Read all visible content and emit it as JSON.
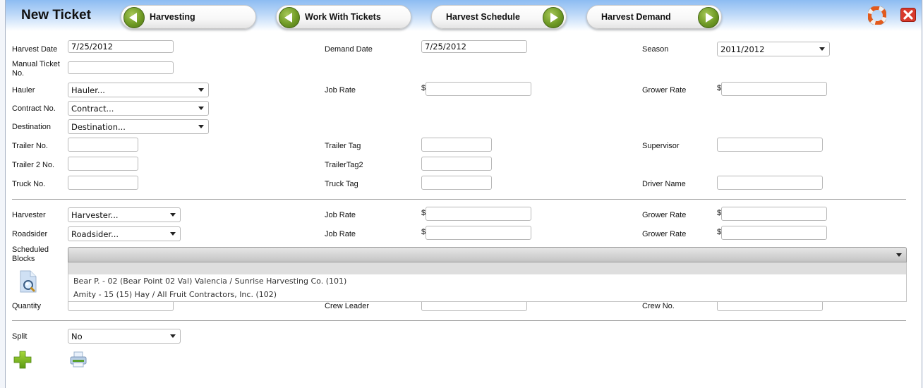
{
  "header": {
    "title": "New Ticket",
    "nav": [
      {
        "label": "Harvesting",
        "direction": "back"
      },
      {
        "label": "Work With Tickets",
        "direction": "back"
      },
      {
        "label": "Harvest Schedule",
        "direction": "forward"
      },
      {
        "label": "Harvest Demand",
        "direction": "forward"
      }
    ],
    "icons": {
      "help": "lifebuoy-icon",
      "close": "close-icon"
    }
  },
  "form": {
    "harvest_date": {
      "label": "Harvest Date",
      "value": "7/25/2012"
    },
    "demand_date": {
      "label": "Demand Date",
      "value": "7/25/2012"
    },
    "season": {
      "label": "Season",
      "value": "2011/2012"
    },
    "manual_ticket": {
      "label": "Manual Ticket No.",
      "value": ""
    },
    "hauler": {
      "label": "Hauler",
      "value": "Hauler..."
    },
    "hauler_job_rate": {
      "label": "Job Rate",
      "currency": "$",
      "value": ""
    },
    "hauler_grower_rate": {
      "label": "Grower Rate",
      "currency": "$",
      "value": ""
    },
    "contract": {
      "label": "Contract No.",
      "value": "Contract..."
    },
    "destination": {
      "label": "Destination",
      "value": "Destination..."
    },
    "trailer_no": {
      "label": "Trailer No.",
      "value": ""
    },
    "trailer_tag": {
      "label": "Trailer Tag",
      "value": ""
    },
    "supervisor": {
      "label": "Supervisor",
      "value": ""
    },
    "trailer2_no": {
      "label": "Trailer 2 No.",
      "value": ""
    },
    "trailer_tag2": {
      "label": "TrailerTag2",
      "value": ""
    },
    "truck_no": {
      "label": "Truck No.",
      "value": ""
    },
    "truck_tag": {
      "label": "Truck Tag",
      "value": ""
    },
    "driver_name": {
      "label": "Driver Name",
      "value": ""
    },
    "harvester": {
      "label": "Harvester",
      "value": "Harvester..."
    },
    "harvester_job_rate": {
      "label": "Job Rate",
      "currency": "$",
      "value": ""
    },
    "harvester_grower_rate": {
      "label": "Grower Rate",
      "currency": "$",
      "value": ""
    },
    "roadsider": {
      "label": "Roadsider",
      "value": "Roadsider..."
    },
    "roadsider_job_rate": {
      "label": "Job Rate",
      "currency": "$",
      "value": ""
    },
    "roadsider_grower_rate": {
      "label": "Grower Rate",
      "currency": "$",
      "value": ""
    },
    "scheduled_blocks": {
      "label": "Scheduled Blocks",
      "value": "",
      "options": [
        "Bear P. - 02 (Bear Point 02 Val) Valencia / Sunrise Harvesting Co. (101)",
        "Amity - 15 (15) Hay / All Fruit Contractors, Inc. (102)"
      ]
    },
    "quantity": {
      "label": "Quantity",
      "value": ""
    },
    "crew_leader": {
      "label": "Crew Leader",
      "value": ""
    },
    "crew_no": {
      "label": "Crew No.",
      "value": ""
    },
    "split": {
      "label": "Split",
      "value": "No"
    }
  },
  "actions": {
    "add": "add-icon",
    "print": "print-icon",
    "search_blocks": "search-document-icon"
  }
}
